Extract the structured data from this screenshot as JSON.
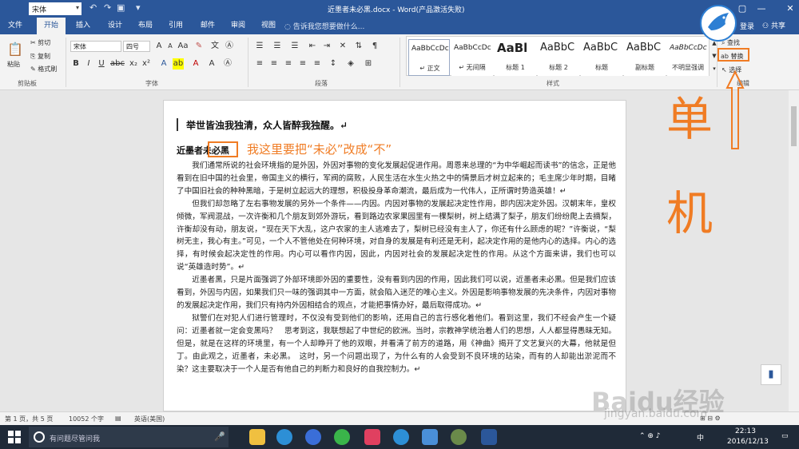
{
  "titlebar": {
    "font_name": "宋体",
    "doc_title": "近墨者未必黑.docx - Word(产品激活失败)"
  },
  "tabs": [
    "文件",
    "开始",
    "插入",
    "设计",
    "布局",
    "引用",
    "邮件",
    "审阅",
    "视图"
  ],
  "tell_me": "告诉我您想要做什么...",
  "login": "登录",
  "share": "共享",
  "clipboard": {
    "paste": "粘贴",
    "cut": "剪切",
    "copy": "复制",
    "format_painter": "格式刷",
    "label": "剪贴板"
  },
  "font_group": {
    "font_name": "宋体",
    "font_size": "四号",
    "label": "字体"
  },
  "paragraph_label": "段落",
  "styles": [
    {
      "sample": "AaBbCcDc",
      "name": "↵ 正文"
    },
    {
      "sample": "AaBbCcDc",
      "name": "↵ 无间隔"
    },
    {
      "sample": "AaBl",
      "name": "标题 1"
    },
    {
      "sample": "AaBbC",
      "name": "标题 2"
    },
    {
      "sample": "AaBbC",
      "name": "标题"
    },
    {
      "sample": "AaBbC",
      "name": "副标题"
    },
    {
      "sample": "AaBbCcDc",
      "name": "不明显强调"
    }
  ],
  "styles_label": "样式",
  "editing": {
    "find": "查找",
    "replace": "替换",
    "select": "选择",
    "label": "编辑"
  },
  "document": {
    "heading1": "举世皆浊我独清，众人皆醉我独醒。↵",
    "heading2": "近墨者未必黑",
    "annotation": "我这里要把“未必”改成“不”",
    "paragraphs": [
      "我们通常所说的社会环境指的是外因，外因对事物的变化发展起促进作用。周恩来总理的“为中华崛起而读书”的信念，正是他看到在旧中国的社会里，帝国主义的横行，军阀的腐败，人民生活在水生火热之中的情景后才树立起来的；毛主席少年时期，目睹了中国旧社会的种种黑暗，于是树立起远大的理想，积极投身革命潮流，最后成为一代伟人，正所谓时势造英雄！↵",
      "但我们却忽略了左右事物发展的另外一个条件——内因。内因对事物的发展起决定性作用，即内因决定外因。汉朝末年，皇权倾微，军阀混战，一次许衡和几个朋友到郊外游玩，看到路边农家果园里有一棵梨树，树上结满了梨子，朋友们纷纷爬上去摘梨，许衡却没有动，朋友说，“现在天下大乱，这户农家的主人逃难去了，梨树已经没有主人了，你还有什么顾虑的呢？”许衡说，“梨树无主，我心有主。”可见，一个人不管他处在何种环境，对自身的发展是有利还是无利，起决定作用的是他内心的选择。内心的选择，有时候会起决定性的作用。内心可以看作内因，因此，内因对社会的发展起决定性的作用。从这个方面来讲，我们也可以说“英雄造时势”。↵",
      "近墨者黑，只是片面强调了外部环境即外因的重要性，没有看到内因的作用，因此我们可以说，近墨者未必黑。但是我们应该看到，外因与内因，如果我们只一味的强调其中一方面，就会陷入迷茫的唯心主义。外因是影响事物发展的先决条件，内因对事物的发展起决定作用，我们只有持内外因相结合的观点，才能把事情办好，最后取得成功。↵",
      "狱警们在对犯人们进行管理时，不仅没有受到他们的影响，还用自己的言行感化着他们。看到这里，我们不经会产生一个疑问：近墨者就一定会变黑吗？　思考到这，我联想起了中世纪的欧洲。当时，宗教神学统治着人们的思想，人人都显得愚昧无知。但是，就是在这样的环境里，有一个人却睁开了他的双眼，并看清了前方的道路，用《神曲》揭开了文艺复兴的大幕，他就是但丁。由此观之，近墨者，未必黑。　这时，另一个问题出现了，为什么有的人会受到不良环境的玷染，而有的人却能出淤泥而不染？这主要取决于一个人是否有他自己的判断力和良好的自我控制力。↵"
    ]
  },
  "annotations": {
    "char1": "单",
    "char2": "机"
  },
  "statusbar": {
    "page": "第 1 页，共 5 页",
    "words": "10052 个字",
    "lang": "英语(美国)"
  },
  "taskbar": {
    "search": "有问题尽管问我",
    "time": "22:13",
    "date": "2016/12/13",
    "ime": "中"
  },
  "watermark": {
    "brand": "Baidu经验",
    "url": "jingyan.baidu.com"
  }
}
